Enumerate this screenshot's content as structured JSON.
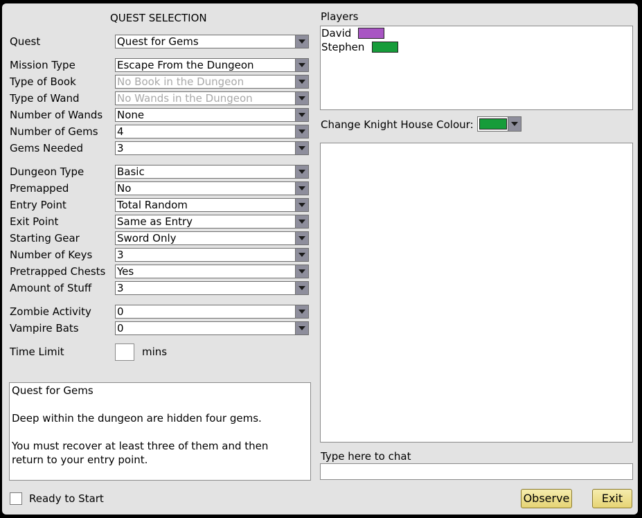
{
  "left": {
    "title": "QUEST SELECTION",
    "fields": [
      {
        "label": "Quest",
        "value": "Quest for Gems",
        "disabled": false
      },
      {
        "label": "Mission Type",
        "value": "Escape From the Dungeon",
        "disabled": false
      },
      {
        "label": "Type of Book",
        "value": "No Book in the Dungeon",
        "disabled": true
      },
      {
        "label": "Type of Wand",
        "value": "No Wands in the Dungeon",
        "disabled": true
      },
      {
        "label": "Number of Wands",
        "value": "None",
        "disabled": false
      },
      {
        "label": "Number of Gems",
        "value": "4",
        "disabled": false
      },
      {
        "label": "Gems Needed",
        "value": "3",
        "disabled": false
      },
      {
        "label": "Dungeon Type",
        "value": "Basic",
        "disabled": false
      },
      {
        "label": "Premapped",
        "value": "No",
        "disabled": false
      },
      {
        "label": "Entry Point",
        "value": "Total Random",
        "disabled": false
      },
      {
        "label": "Exit Point",
        "value": "Same as Entry",
        "disabled": false
      },
      {
        "label": "Starting Gear",
        "value": "Sword Only",
        "disabled": false
      },
      {
        "label": "Number of Keys",
        "value": "3",
        "disabled": false
      },
      {
        "label": "Pretrapped Chests",
        "value": "Yes",
        "disabled": false
      },
      {
        "label": "Amount of Stuff",
        "value": "3",
        "disabled": false
      },
      {
        "label": "Zombie Activity",
        "value": "0",
        "disabled": false
      },
      {
        "label": "Vampire Bats",
        "value": "0",
        "disabled": false
      }
    ],
    "time_limit": {
      "label": "Time Limit",
      "value": "",
      "unit": "mins"
    },
    "description": [
      "Quest for Gems",
      "",
      "Deep within the dungeon are hidden four gems.",
      "",
      "You must recover at least three of them and then",
      "return to your entry point."
    ],
    "ready": {
      "label": "Ready to Start",
      "checked": false
    }
  },
  "right": {
    "players_label": "Players",
    "players": [
      {
        "name": "David",
        "color": "#a855c3"
      },
      {
        "name": "Stephen",
        "color": "#169c3a"
      }
    ],
    "house_colour_label": "Change Knight House Colour:",
    "house_colour": "#169c3a",
    "chat_label": "Type here to chat",
    "chat_value": "",
    "observe_label": "Observe",
    "exit_label": "Exit"
  }
}
